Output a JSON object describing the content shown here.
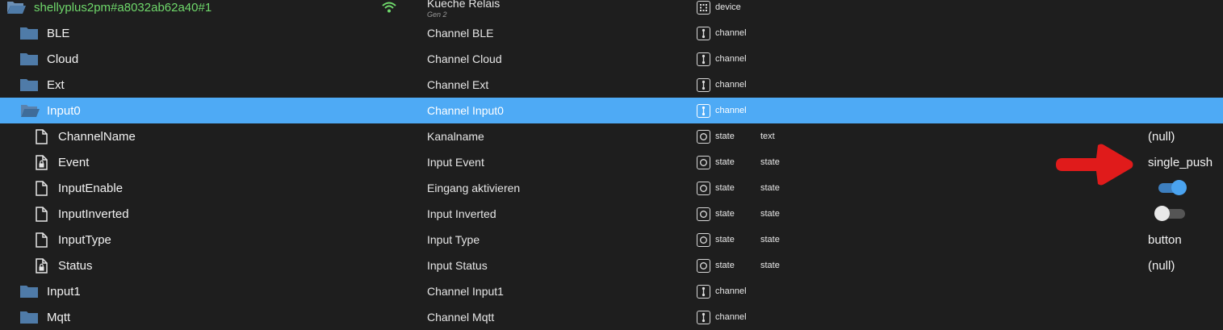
{
  "device": {
    "name": "shellyplus2pm#a8032ab62a40#1",
    "description": "Kueche Relais",
    "sub": "Gen 2",
    "role": "device"
  },
  "channels_top": [
    {
      "name": "BLE",
      "description": "Channel BLE",
      "role": "channel"
    },
    {
      "name": "Cloud",
      "description": "Channel Cloud",
      "role": "channel"
    },
    {
      "name": "Ext",
      "description": "Channel Ext",
      "role": "channel"
    }
  ],
  "selected_channel": {
    "name": "Input0",
    "description": "Channel Input0",
    "role": "channel"
  },
  "states": [
    {
      "name": "ChannelName",
      "description": "Kanalname",
      "role": "state",
      "type": "text",
      "value": "(null)",
      "locked": false
    },
    {
      "name": "Event",
      "description": "Input Event",
      "role": "state",
      "type": "state",
      "value": "single_push",
      "locked": true
    },
    {
      "name": "InputEnable",
      "description": "Eingang aktivieren",
      "role": "state",
      "type": "state",
      "value": "",
      "toggle_on": true,
      "locked": false
    },
    {
      "name": "InputInverted",
      "description": "Input Inverted",
      "role": "state",
      "type": "state",
      "value": "",
      "toggle_on": false,
      "locked": false
    },
    {
      "name": "InputType",
      "description": "Input Type",
      "role": "state",
      "type": "state",
      "value": "button",
      "locked": false
    },
    {
      "name": "Status",
      "description": "Input Status",
      "role": "state",
      "type": "state",
      "value": "(null)",
      "locked": true
    }
  ],
  "channels_bottom": [
    {
      "name": "Input1",
      "description": "Channel Input1",
      "role": "channel"
    },
    {
      "name": "Mqtt",
      "description": "Channel Mqtt",
      "role": "channel"
    }
  ],
  "colors": {
    "background": "#1e1e1e",
    "selected": "#4eaaf5",
    "device_name": "#6fd86b",
    "folder": "#4f7ba8",
    "toggle_on": "#4aa3ef",
    "arrow": "#e01b1b"
  },
  "icons": {
    "wifi": "wifi-icon",
    "folder": "folder-icon",
    "folder_open": "folder-open-icon",
    "file": "file-icon",
    "file_locked": "file-lock-icon",
    "device_role": "device-role-icon",
    "channel_role": "channel-role-icon",
    "state_role": "state-role-icon",
    "annotation": "red-arrow-annotation"
  }
}
